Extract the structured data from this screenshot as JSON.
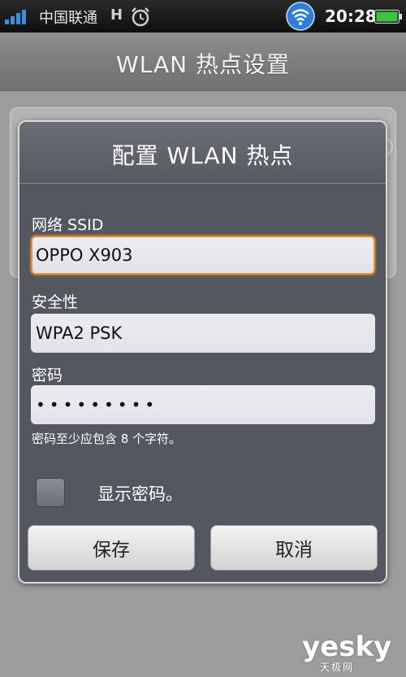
{
  "status_bar": {
    "carrier": "中国联通",
    "network_type": "H",
    "time": "20:28",
    "icons": [
      "signal-icon",
      "alarm-icon",
      "wifi-hotspot-icon",
      "battery-icon"
    ]
  },
  "title_bar": {
    "title": "WLAN 热点设置"
  },
  "dialog": {
    "title": "配置 WLAN 热点",
    "ssid": {
      "label": "网络 SSID",
      "value": "OPPO X903"
    },
    "security": {
      "label": "安全性",
      "value": "WPA2 PSK"
    },
    "password": {
      "label": "密码",
      "value": "•••••••••",
      "hint": "密码至少应包含 8 个字符。"
    },
    "show_password": {
      "label": "显示密码。",
      "checked": false
    },
    "save_label": "保存",
    "cancel_label": "取消"
  },
  "watermark": {
    "main": "yesky",
    "sub": "天极网"
  },
  "colors": {
    "focus_accent": "#e8902a",
    "dialog_bg": "#54575f",
    "battery_green": "#3cc43c"
  }
}
